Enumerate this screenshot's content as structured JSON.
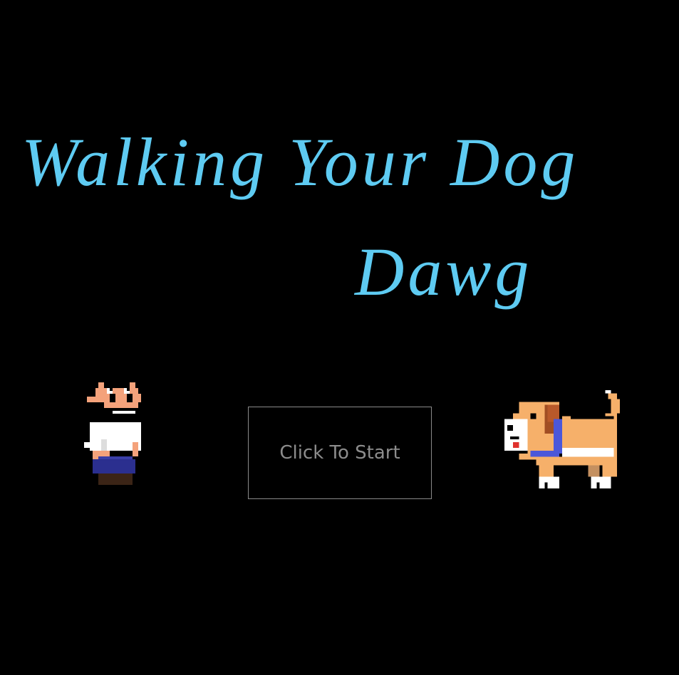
{
  "game": {
    "title_line1": "Walking Your Dog",
    "title_line2": "Dawg",
    "start_button_label": "Click To Start"
  },
  "colors": {
    "background": "#000000",
    "title": "#5ecbf2",
    "button_text": "#8c8c8c",
    "button_border": "#8a8a8a"
  },
  "sprites": {
    "player": "walker-character-sprite",
    "dog": "bulldog-sprite"
  }
}
